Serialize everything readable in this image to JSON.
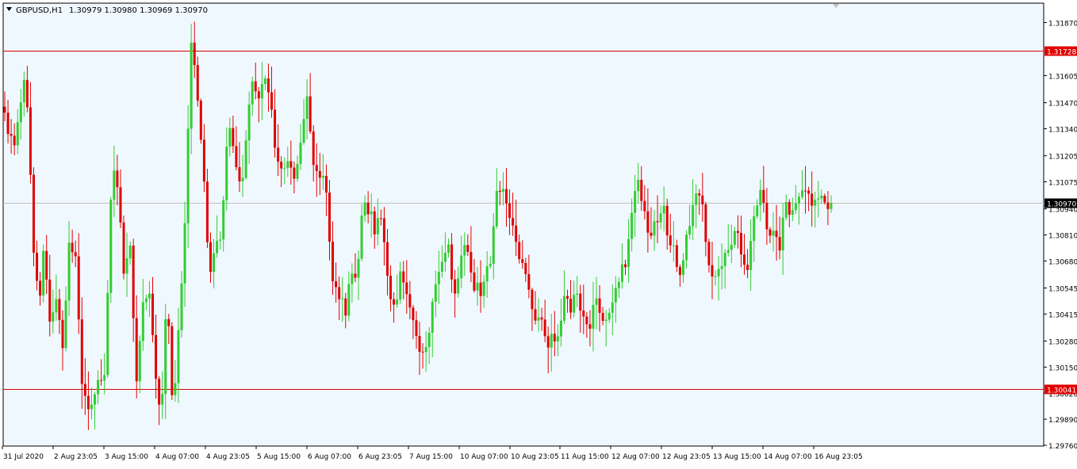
{
  "header": {
    "symbol": "GBPUSD,H1",
    "ohlc": "1.30979 1.30980 1.30969 1.30970"
  },
  "price_tags": {
    "resistance": "1.31728",
    "support": "1.30041",
    "current": "1.30970"
  },
  "colors": {
    "background": "#f0f8ff",
    "bull": "#32cd32",
    "bear": "#e00000",
    "level_line": "#e00000",
    "current_line": "#c0c0c0",
    "frame": "#000000"
  },
  "chart_data": {
    "type": "candlestick",
    "symbol": "GBPUSD",
    "timeframe": "H1",
    "ylim": [
      1.2976,
      1.3187
    ],
    "y_ticks": [
      "1.31870",
      "1.31605",
      "1.31470",
      "1.31340",
      "1.31205",
      "1.31075",
      "1.30940",
      "1.30810",
      "1.30680",
      "1.30545",
      "1.30415",
      "1.30280",
      "1.30150",
      "1.30020",
      "1.29890",
      "1.29760"
    ],
    "x_ticks": [
      "31 Jul 2020",
      "2 Aug 23:05",
      "3 Aug 15:00",
      "4 Aug 07:00",
      "4 Aug 23:05",
      "5 Aug 15:00",
      "6 Aug 07:00",
      "6 Aug 23:05",
      "7 Aug 15:00",
      "10 Aug 07:00",
      "10 Aug 23:05",
      "11 Aug 15:00",
      "12 Aug 07:00",
      "12 Aug 23:05",
      "13 Aug 15:00",
      "14 Aug 07:00",
      "16 Aug 23:05"
    ],
    "horizontal_levels": [
      {
        "price": 1.31728,
        "label": "1.31728",
        "color": "#e00000"
      },
      {
        "price": 1.30041,
        "label": "1.30041",
        "color": "#e00000"
      },
      {
        "price": 1.3097,
        "label": "1.30970",
        "color": "#c0c0c0",
        "current": true
      }
    ],
    "path_points": [
      [
        1.3145,
        1.3135
      ],
      [
        1.3125,
        1.3142
      ],
      [
        1.3165,
        1.3085
      ],
      [
        1.3045,
        1.3075
      ],
      [
        1.303,
        1.305
      ],
      [
        1.302,
        1.308
      ],
      [
        1.3072,
        1.301
      ],
      [
        1.2992,
        1.3003
      ],
      [
        1.301,
        1.3015
      ],
      [
        1.3115,
        1.3105
      ],
      [
        1.306,
        1.308
      ],
      [
        1.3005,
        1.3045
      ],
      [
        1.3055,
        1.3015
      ],
      [
        1.2985,
        1.3055
      ],
      [
        1.2995,
        1.3035
      ],
      [
        1.309,
        1.318
      ],
      [
        1.3148,
        1.3108
      ],
      [
        1.3063,
        1.3075
      ],
      [
        1.3082,
        1.3134
      ],
      [
        1.3122,
        1.3102
      ],
      [
        1.3132,
        1.3155
      ],
      [
        1.3153,
        1.316
      ],
      [
        1.3147,
        1.3118
      ],
      [
        1.311,
        1.3115
      ],
      [
        1.3113,
        1.313
      ],
      [
        1.3148,
        1.3115
      ],
      [
        1.3106,
        1.3108
      ],
      [
        1.306,
        1.3055
      ],
      [
        1.304,
        1.3061
      ],
      [
        1.3058,
        1.3095
      ],
      [
        1.3095,
        1.3083
      ],
      [
        1.309,
        1.306
      ],
      [
        1.304,
        1.306
      ],
      [
        1.3052,
        1.3045
      ],
      [
        1.3028,
        1.3023
      ],
      [
        1.3035,
        1.306
      ],
      [
        1.307,
        1.3078
      ],
      [
        1.3047,
        1.307
      ],
      [
        1.3075,
        1.3055
      ],
      [
        1.3052,
        1.306
      ],
      [
        1.3068,
        1.3108
      ],
      [
        1.3105,
        1.3085
      ],
      [
        1.308,
        1.3065
      ],
      [
        1.3055,
        1.3037
      ],
      [
        1.3045,
        1.3023
      ],
      [
        1.3032,
        1.303
      ],
      [
        1.305,
        1.3045
      ],
      [
        1.3056,
        1.304
      ],
      [
        1.3027,
        1.3055
      ],
      [
        1.3038,
        1.304
      ],
      [
        1.3047,
        1.3063
      ],
      [
        1.3068,
        1.309
      ],
      [
        1.3108,
        1.309
      ],
      [
        1.3081,
        1.3085
      ],
      [
        1.3099,
        1.3077
      ],
      [
        1.307,
        1.306
      ],
      [
        1.3085,
        1.3095
      ],
      [
        1.3105,
        1.308
      ],
      [
        1.306,
        1.306
      ],
      [
        1.307,
        1.3078
      ],
      [
        1.3085,
        1.3071
      ],
      [
        1.3063,
        1.309
      ],
      [
        1.31,
        1.3085
      ],
      [
        1.308,
        1.3075
      ],
      [
        1.3095,
        1.3092
      ],
      [
        1.3102,
        1.3105
      ],
      [
        1.3099,
        1.31
      ],
      [
        1.3097,
        1.3097
      ]
    ]
  }
}
